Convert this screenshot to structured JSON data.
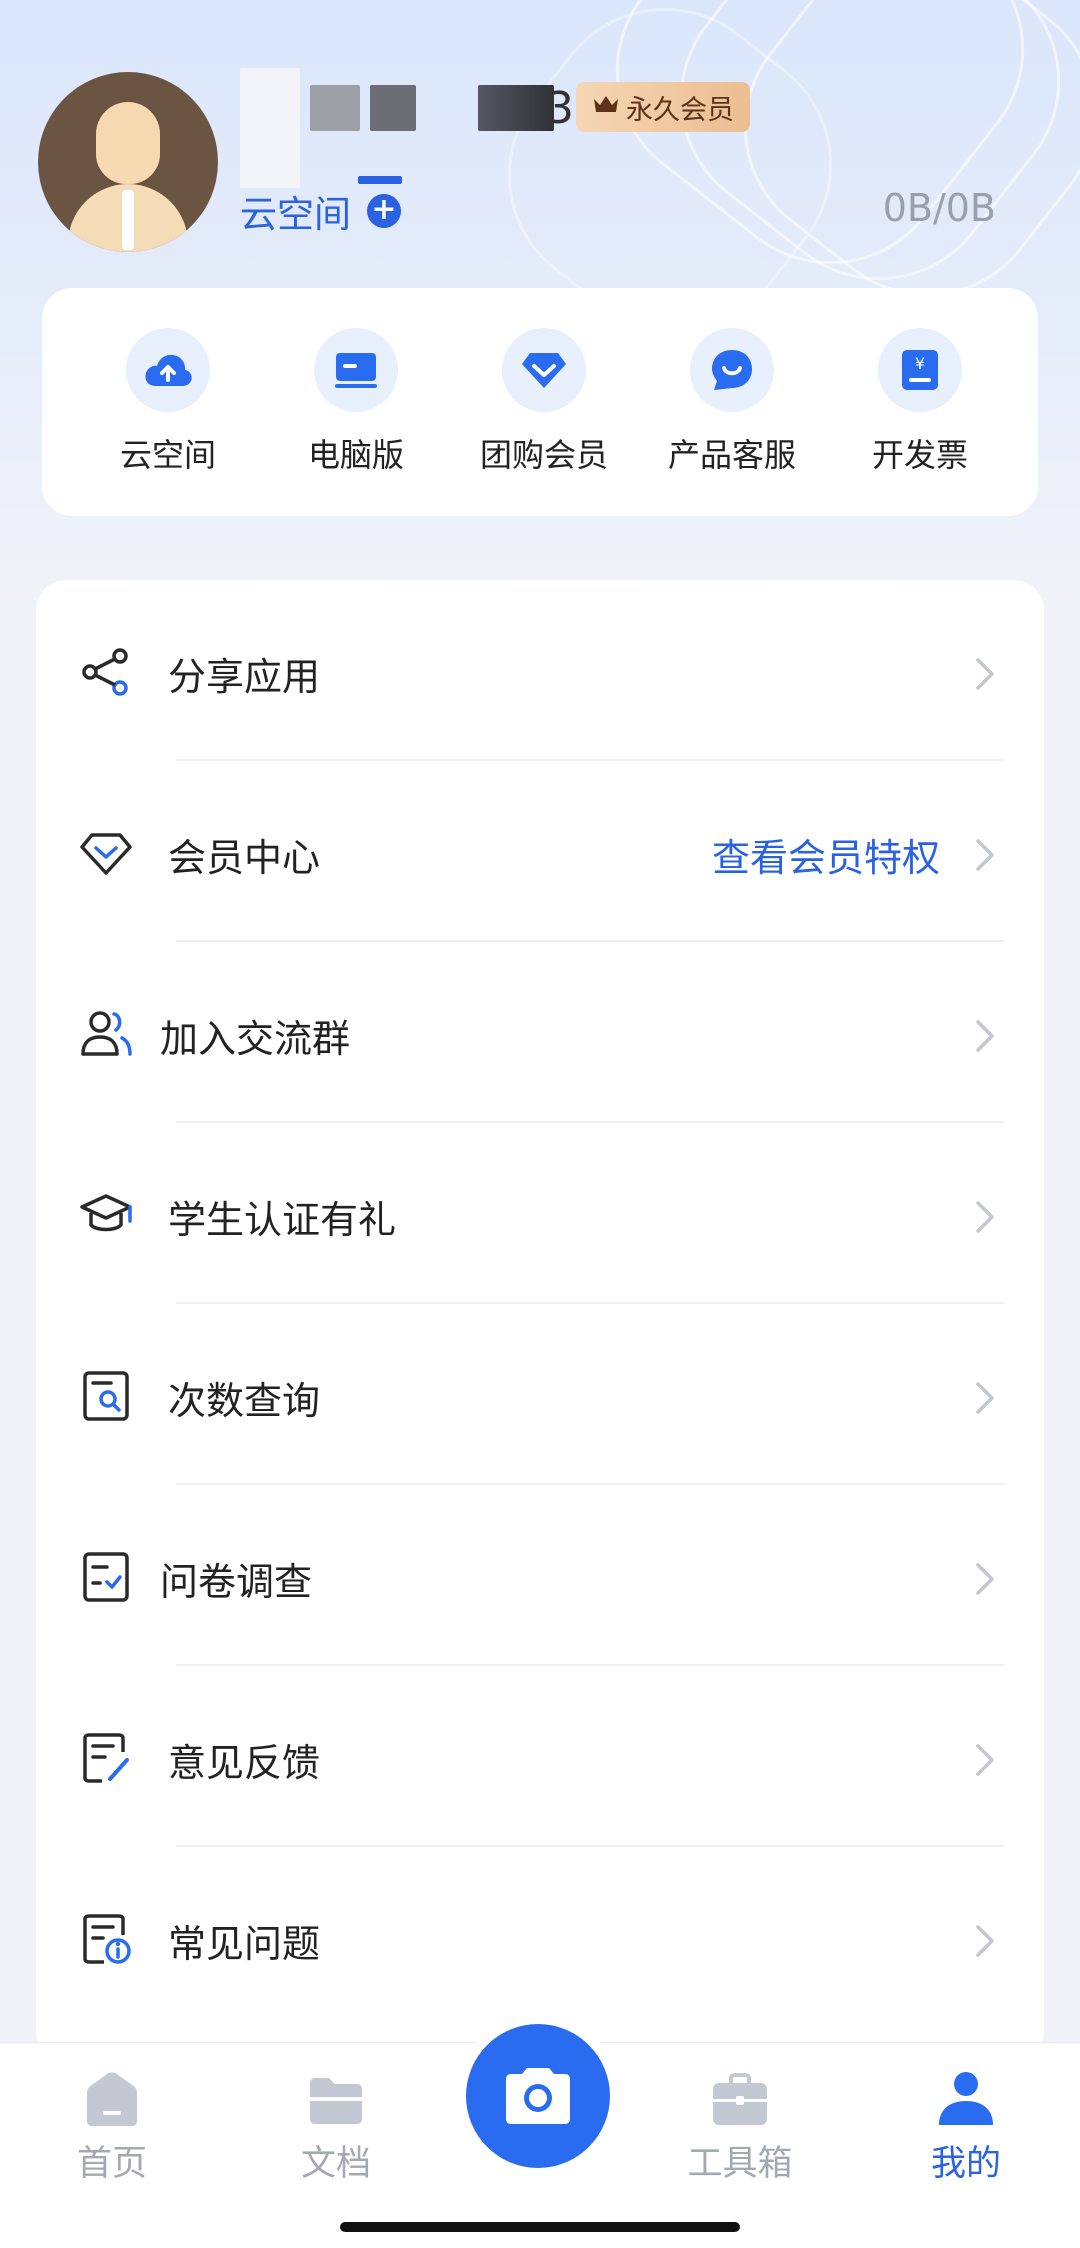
{
  "profile": {
    "name_visible_suffix": "3",
    "vip_badge": "永久会员",
    "cloud_space_label": "云空间",
    "storage": "0B/0B"
  },
  "quick_actions": [
    {
      "label": "云空间",
      "icon": "cloud-upload-icon"
    },
    {
      "label": "电脑版",
      "icon": "laptop-icon"
    },
    {
      "label": "团购会员",
      "icon": "diamond-icon"
    },
    {
      "label": "产品客服",
      "icon": "chat-bubble-icon"
    },
    {
      "label": "开发票",
      "icon": "invoice-yen-icon"
    }
  ],
  "menu": [
    {
      "label": "分享应用",
      "icon": "share-icon"
    },
    {
      "label": "会员中心",
      "icon": "diamond-outline-icon",
      "extra": "查看会员特权"
    },
    {
      "label": "加入交流群",
      "icon": "user-group-icon"
    },
    {
      "label": "学生认证有礼",
      "icon": "graduation-cap-icon"
    },
    {
      "label": "次数查询",
      "icon": "search-document-icon"
    },
    {
      "label": "问卷调查",
      "icon": "checklist-icon"
    },
    {
      "label": "意见反馈",
      "icon": "edit-document-icon"
    },
    {
      "label": "常见问题",
      "icon": "faq-document-icon"
    }
  ],
  "bottom_nav": [
    {
      "label": "首页",
      "icon": "home-icon"
    },
    {
      "label": "文档",
      "icon": "folder-icon"
    },
    {
      "label": "工具箱",
      "icon": "toolbox-icon"
    },
    {
      "label": "我的",
      "icon": "user-icon",
      "active": true
    }
  ],
  "colors": {
    "accent": "#2a62e2",
    "badge": "#ecbd92"
  }
}
